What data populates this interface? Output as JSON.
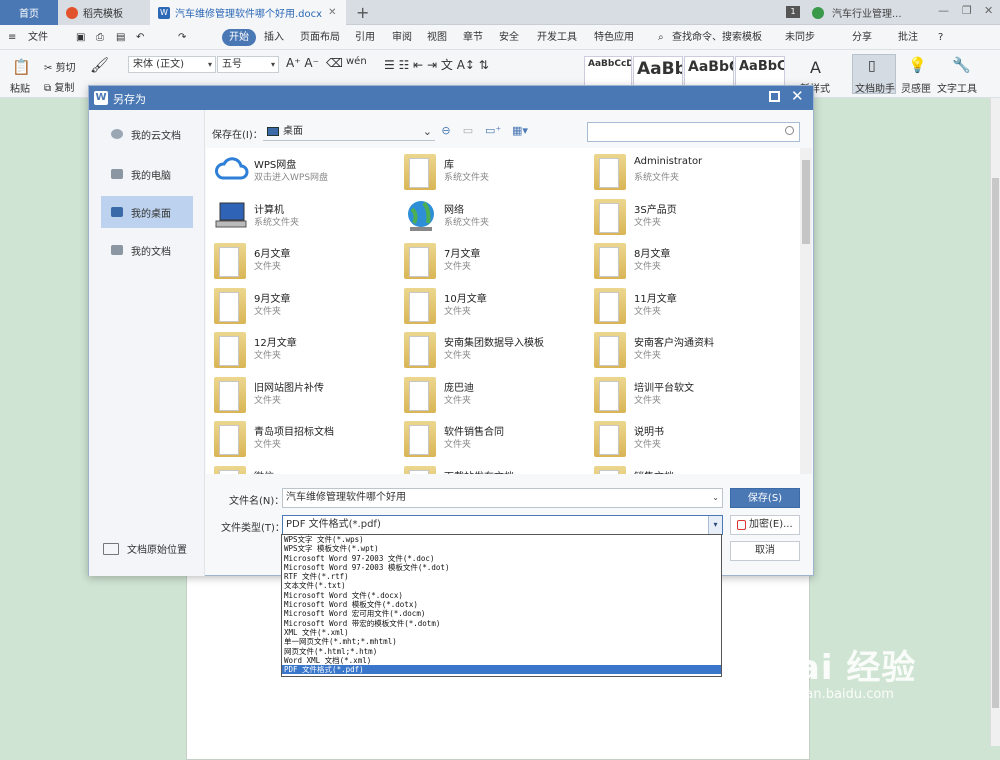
{
  "tabs": {
    "home": "首页",
    "template": "稻壳模板",
    "document": "汽车维修管理软件哪个好用.docx"
  },
  "window": {
    "badge": "1",
    "caption": "汽车行业管理..."
  },
  "menu": {
    "file": "文件",
    "items": [
      "开始",
      "插入",
      "页面布局",
      "引用",
      "审阅",
      "视图",
      "章节",
      "安全",
      "开发工具",
      "特色应用"
    ],
    "search": "查找命令、搜索模板",
    "sync": "未同步",
    "share": "分享",
    "comment": "批注",
    "help": "?"
  },
  "ribbon": {
    "paste": "粘贴",
    "cut": "剪切",
    "copy": "复制",
    "format_painter": "格式刷",
    "font": "宋体 (正文)",
    "size": "五号",
    "styles": [
      "AaBbCcDd",
      "AaBb",
      "AaBbC",
      "AaBbC"
    ],
    "new_style": "新样式",
    "doc_assistant": "文档助手",
    "idea": "灵感匣",
    "text_tools": "文字工具"
  },
  "dialog": {
    "title": "另存为",
    "sidebar": [
      "我的云文档",
      "我的电脑",
      "我的桌面",
      "我的文档"
    ],
    "original_location": "文档原始位置",
    "save_in_label": "保存在(I)：",
    "save_in_value": "桌面",
    "search_placeholder": "",
    "files": [
      {
        "name": "WPS网盘",
        "sub": "双击进入WPS网盘",
        "icon": "cloud-icon"
      },
      {
        "name": "库",
        "sub": "系统文件夹",
        "icon": "library-icon"
      },
      {
        "name": "Administrator",
        "sub": "系统文件夹",
        "icon": "user-folder-icon"
      },
      {
        "name": "计算机",
        "sub": "系统文件夹",
        "icon": "computer-icon"
      },
      {
        "name": "网络",
        "sub": "系统文件夹",
        "icon": "network-icon"
      },
      {
        "name": "3S产品页",
        "sub": "文件夹",
        "icon": "folder-icon"
      },
      {
        "name": "6月文章",
        "sub": "文件夹",
        "icon": "folder-icon"
      },
      {
        "name": "7月文章",
        "sub": "文件夹",
        "icon": "folder-icon"
      },
      {
        "name": "8月文章",
        "sub": "文件夹",
        "icon": "folder-icon"
      },
      {
        "name": "9月文章",
        "sub": "文件夹",
        "icon": "folder-icon"
      },
      {
        "name": "10月文章",
        "sub": "文件夹",
        "icon": "folder-icon"
      },
      {
        "name": "11月文章",
        "sub": "文件夹",
        "icon": "folder-icon"
      },
      {
        "name": "12月文章",
        "sub": "文件夹",
        "icon": "folder-icon"
      },
      {
        "name": "安南集团数据导入模板",
        "sub": "文件夹",
        "icon": "folder-icon"
      },
      {
        "name": "安南客户沟通资料",
        "sub": "文件夹",
        "icon": "folder-icon"
      },
      {
        "name": "旧网站图片补传",
        "sub": "文件夹",
        "icon": "folder-icon"
      },
      {
        "name": "庞巴迪",
        "sub": "文件夹",
        "icon": "folder-icon"
      },
      {
        "name": "培训平台软文",
        "sub": "文件夹",
        "icon": "folder-icon"
      },
      {
        "name": "青岛项目招标文档",
        "sub": "文件夹",
        "icon": "folder-icon"
      },
      {
        "name": "软件销售合同",
        "sub": "文件夹",
        "icon": "folder-icon"
      },
      {
        "name": "说明书",
        "sub": "文件夹",
        "icon": "folder-icon"
      },
      {
        "name": "微信",
        "sub": "",
        "icon": "folder-icon"
      },
      {
        "name": "下载站发布文档",
        "sub": "",
        "icon": "folder-icon"
      },
      {
        "name": "销售文档",
        "sub": "",
        "icon": "folder-icon"
      }
    ],
    "filename_label": "文件名(N)：",
    "filename_value": "汽车维修管理软件哪个好用",
    "filetype_label": "文件类型(T)：",
    "filetype_value": "PDF 文件格式(*.pdf)",
    "save_button": "保存(S)",
    "encrypt_button": "加密(E)...",
    "cancel_button": "取消",
    "filetype_options": [
      "WPS文字 文件(*.wps)",
      "WPS文字 模板文件(*.wpt)",
      "Microsoft Word 97-2003 文件(*.doc)",
      "Microsoft Word 97-2003 模板文件(*.dot)",
      "RTF 文件(*.rtf)",
      "文本文件(*.txt)",
      "Microsoft Word 文件(*.docx)",
      "Microsoft Word 模板文件(*.dotx)",
      "Microsoft Word 宏可用文件(*.docm)",
      "Microsoft Word 带宏的模板文件(*.dotm)",
      "XML 文件(*.xml)",
      "单一网页文件(*.mht;*.mhtml)",
      "网页文件(*.html;*.htm)",
      "Word XML 文档(*.xml)",
      "PDF 文件格式(*.pdf)"
    ],
    "selected_option_index": 14
  },
  "watermark": {
    "logo": "Bai 经验",
    "url": "jingyan.baidu.com"
  },
  "colors": {
    "accent": "#4a78b5",
    "selection": "#3a76c9",
    "doc_bg": "#cfe4d2"
  }
}
